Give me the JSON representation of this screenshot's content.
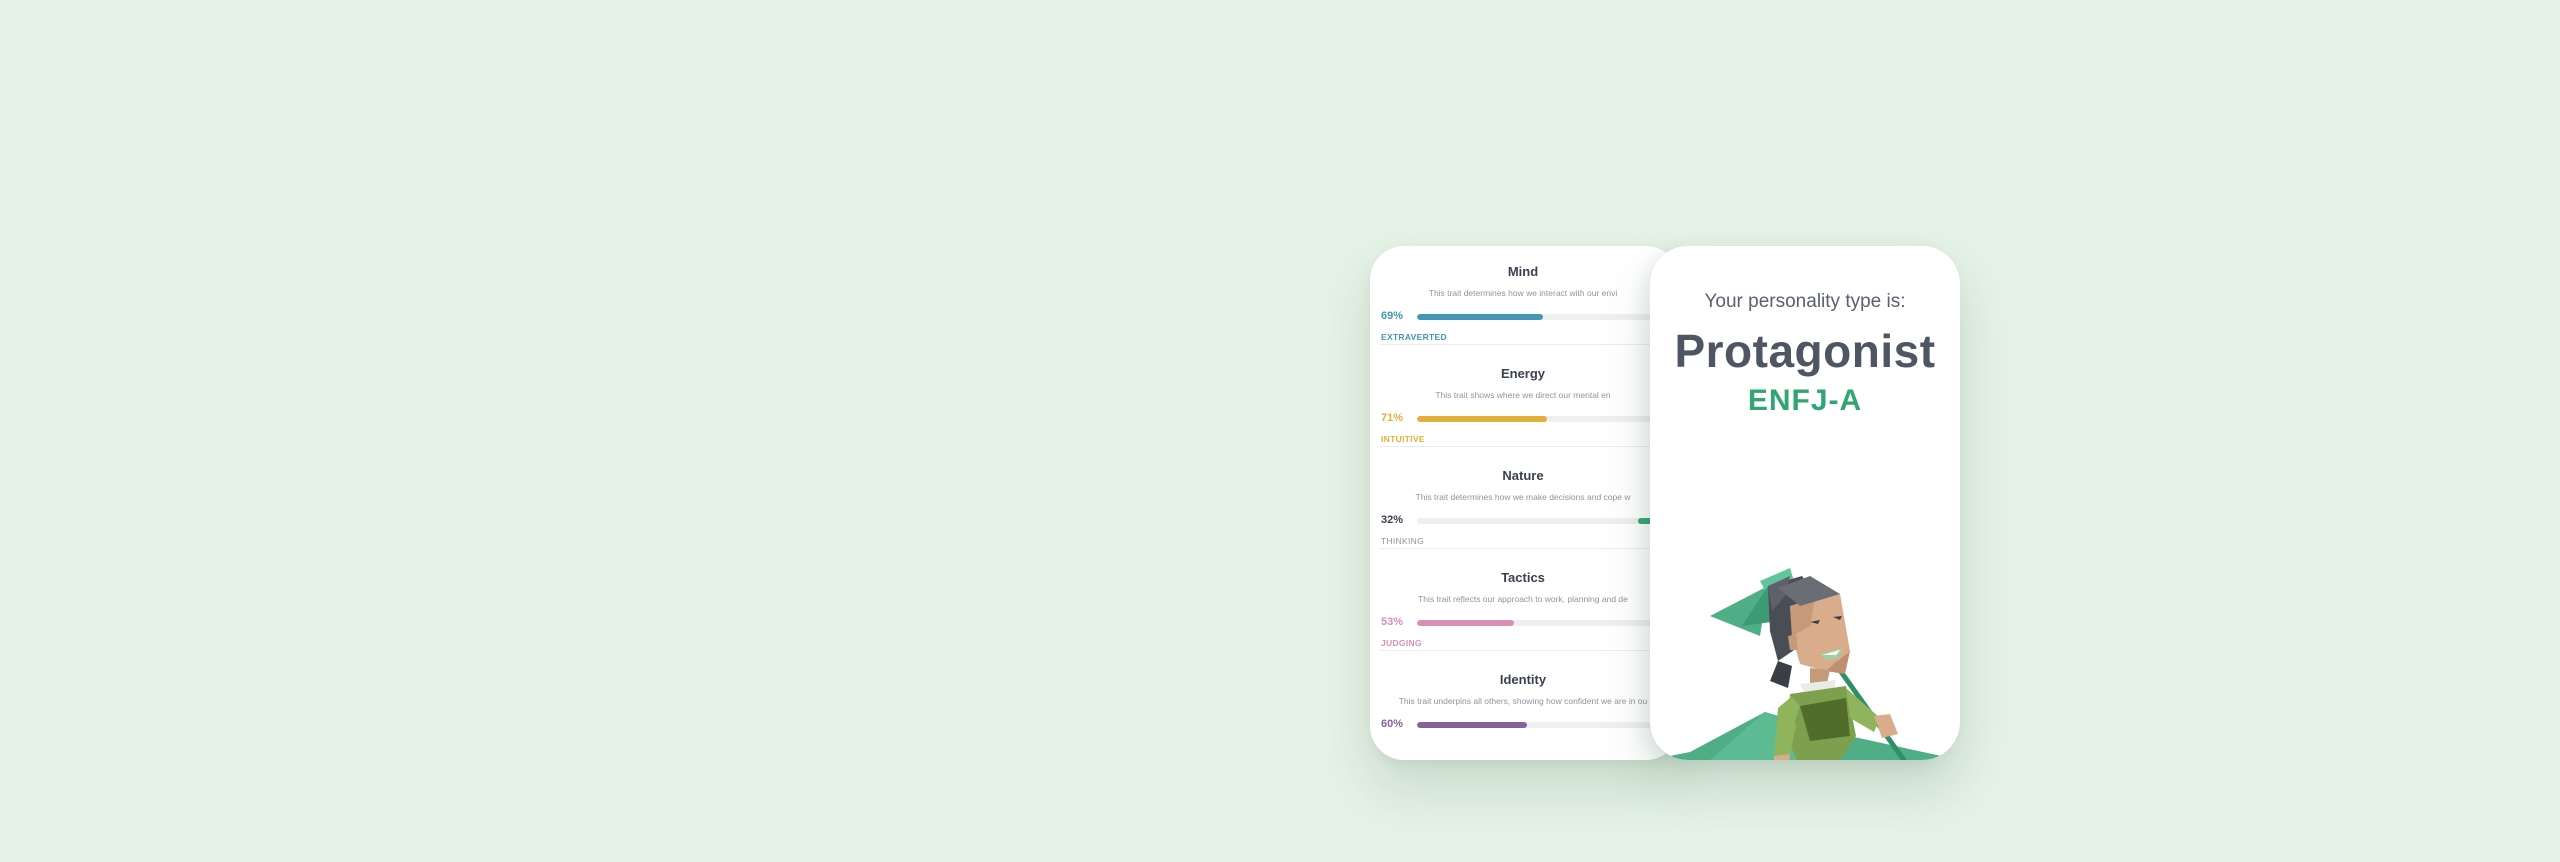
{
  "traits": [
    {
      "title": "Mind",
      "description": "This trait determines how we interact with our envi",
      "percent": "69%",
      "side": "EXTRAVERTED",
      "fill": 0.69,
      "fill_from": "left",
      "color": "#4298b4"
    },
    {
      "title": "Energy",
      "description": "This trait shows where we direct our mental en",
      "percent": "71%",
      "side": "INTUITIVE",
      "fill": 0.71,
      "fill_from": "left",
      "color": "#e4ae3a"
    },
    {
      "title": "Nature",
      "description": "This trait determines how we make decisions and cope w",
      "percent": "32%",
      "side": "THINKING",
      "fill": 0.32,
      "fill_from": "right",
      "color": "#33a474"
    },
    {
      "title": "Tactics",
      "description": "This trait reflects our approach to work, planning and de",
      "percent": "53%",
      "side": "JUDGING",
      "fill": 0.53,
      "fill_from": "left",
      "color": "#d990b6"
    },
    {
      "title": "Identity",
      "description": "This trait underpins all others, showing how confident we are in ou",
      "percent": "60%",
      "side": "",
      "fill": 0.6,
      "fill_from": "left",
      "color": "#88619a"
    }
  ],
  "result": {
    "intro": "Your personality type is:",
    "name": "Protagonist",
    "code": "ENFJ-A"
  },
  "illustration": {
    "icon": "protagonist-character-illustration"
  },
  "colors": {
    "background": "#e5f2e6",
    "accent": "#33a474",
    "heading": "#4e5563"
  }
}
